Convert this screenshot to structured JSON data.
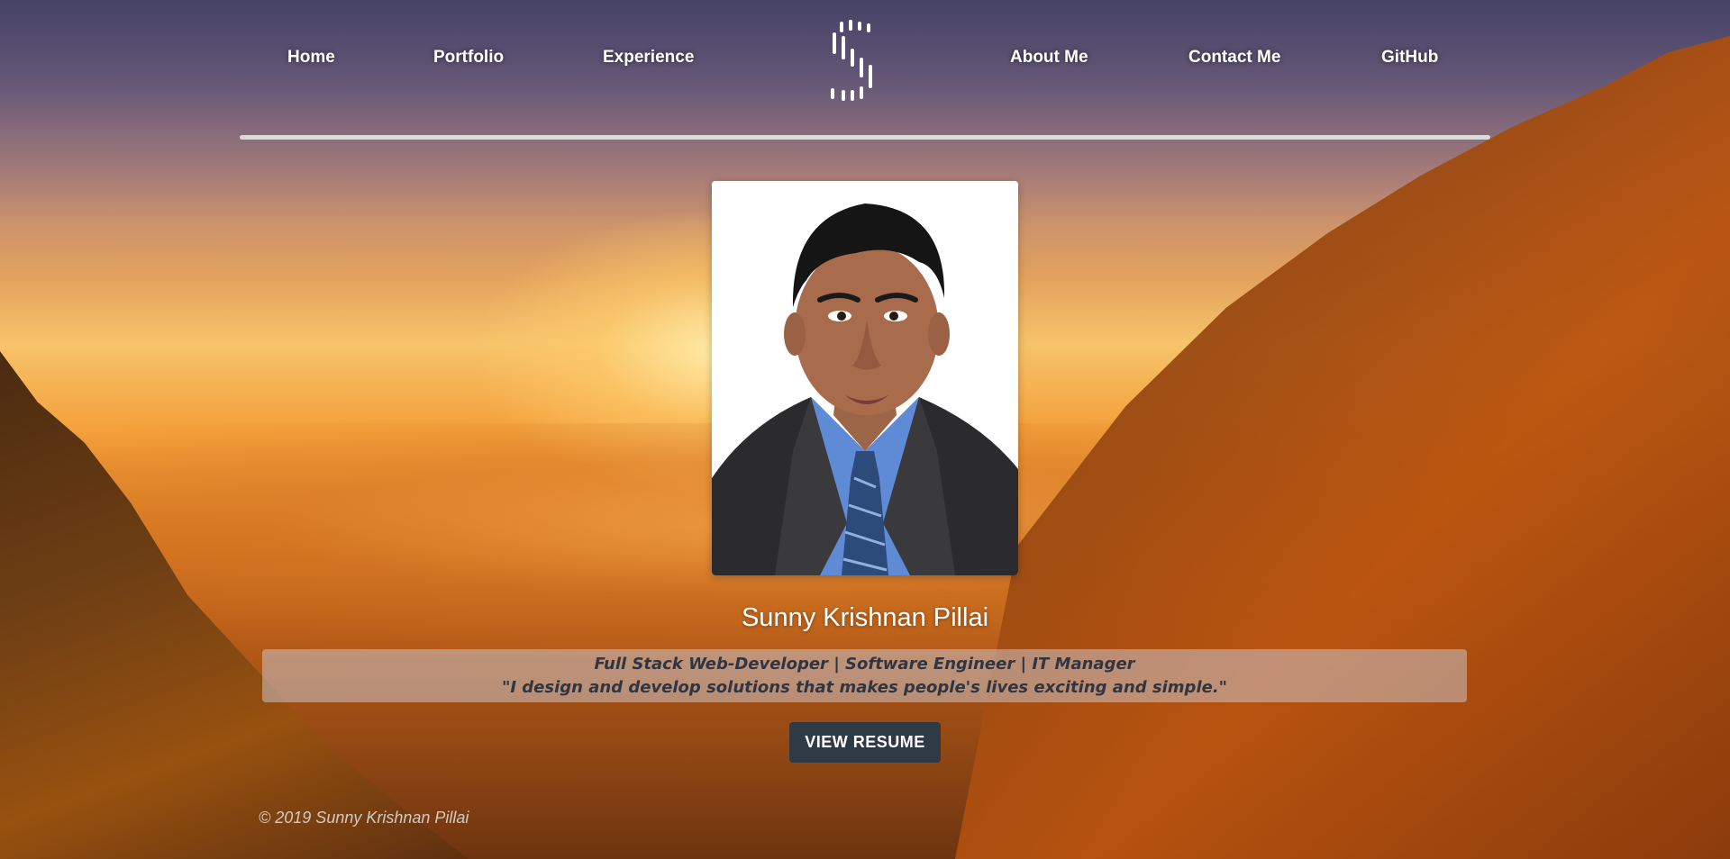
{
  "nav": {
    "links": [
      {
        "label": "Home"
      },
      {
        "label": "Portfolio"
      },
      {
        "label": "Experience"
      },
      {
        "label": "About Me"
      },
      {
        "label": "Contact Me"
      },
      {
        "label": "GitHub"
      }
    ],
    "logo_icon": "stylized-s-logo-icon"
  },
  "hero": {
    "photo_icon": "profile-photo",
    "name": "Sunny Krishnan Pillai",
    "role": "Full Stack Web-Developer | Software Engineer | IT Manager",
    "quote": "\"I design and develop solutions that makes people's lives exciting and simple.\"",
    "button_label": "VIEW RESUME"
  },
  "footer": {
    "copyright": "© 2019 Sunny Krishnan Pillai"
  },
  "colors": {
    "button_bg": "#2f3a45",
    "text_dark": "#2f3542",
    "nav_text": "#ffffff"
  }
}
